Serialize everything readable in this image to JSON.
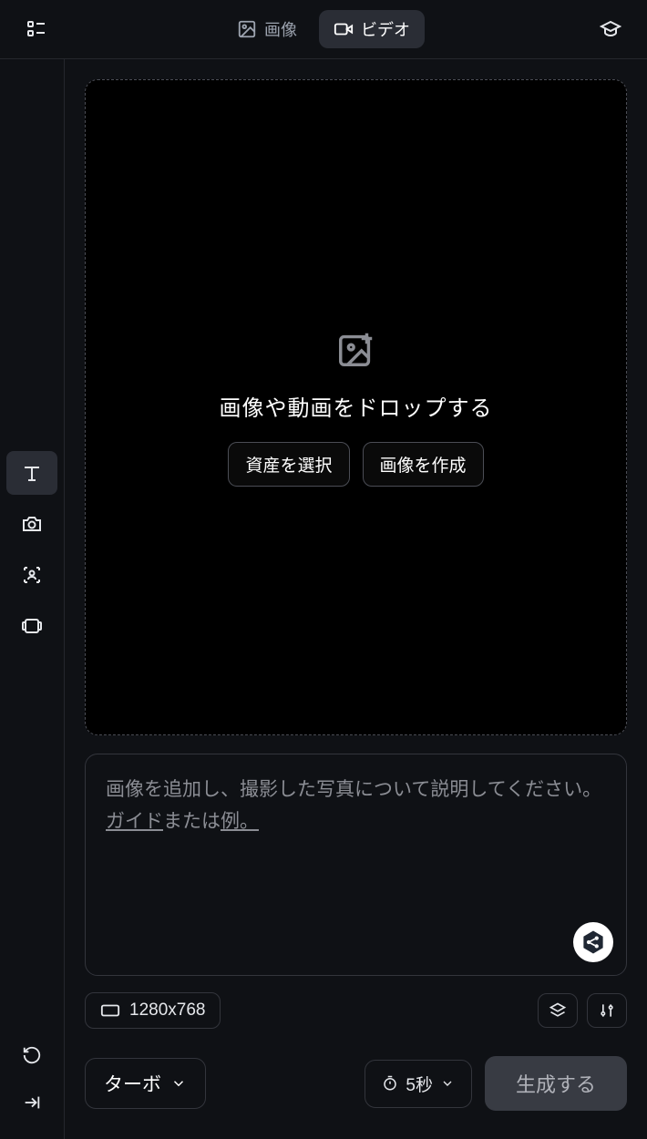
{
  "tabs": {
    "image": "画像",
    "video": "ビデオ"
  },
  "drop": {
    "title": "画像や動画をドロップする",
    "select_asset": "資産を選択",
    "create_image": "画像を作成"
  },
  "prompt": {
    "placeholder_prefix": "画像を追加し、撮影した写真について説明してください。",
    "guide": "ガイド",
    "or": "または",
    "example": "例。"
  },
  "size": {
    "resolution": "1280x768"
  },
  "bottom": {
    "turbo": "ターボ",
    "duration": "5秒",
    "generate": "生成する"
  }
}
